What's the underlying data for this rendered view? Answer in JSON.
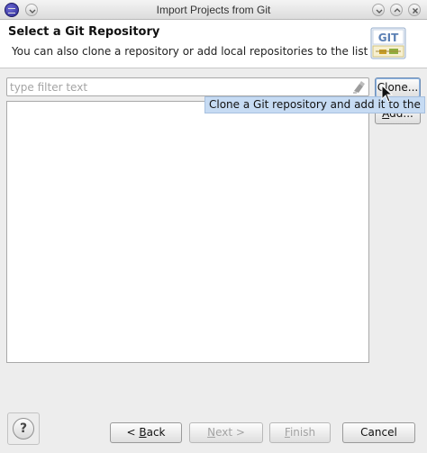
{
  "window": {
    "title": "Import Projects from Git"
  },
  "header": {
    "title": "Select a Git Repository",
    "description": "You can also clone a repository or add local repositories to the list",
    "logo_text": "GIT",
    "logo_icon": "git-logo-icon"
  },
  "filter": {
    "placeholder": "type filter text",
    "value": ""
  },
  "buttons": {
    "clone_prefix": "C",
    "clone_mnemonic": "l",
    "clone_suffix": "one...",
    "add_prefix": "",
    "add_mnemonic": "A",
    "add_suffix": "dd...",
    "back_prefix": "< ",
    "back_mnemonic": "B",
    "back_suffix": "ack",
    "next_prefix": "",
    "next_mnemonic": "N",
    "next_suffix": "ext >",
    "finish_prefix": "",
    "finish_mnemonic": "F",
    "finish_suffix": "inish",
    "cancel": "Cancel",
    "help": "?"
  },
  "tooltip": {
    "text": "Clone a Git repository and add it to the list"
  },
  "colors": {
    "tooltip_bg": "#c6dbf3",
    "accent": "#2c2990"
  }
}
